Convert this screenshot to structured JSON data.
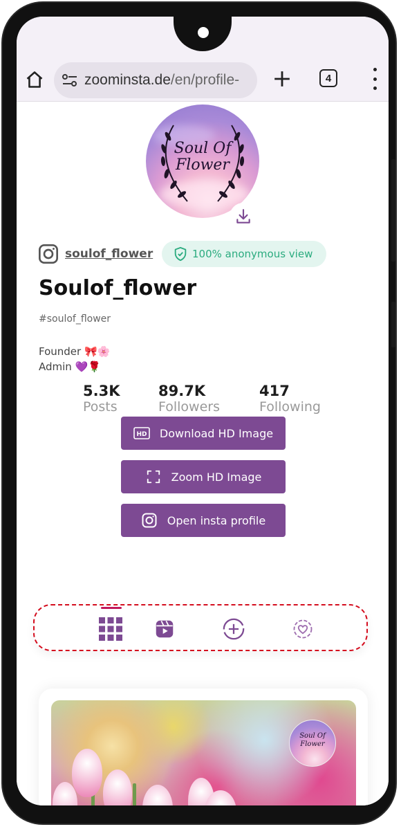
{
  "browser": {
    "url_main": "zoominsta.de",
    "url_path": "/en/profile-",
    "tab_count": "4"
  },
  "profile": {
    "avatar_text_line1": "Soul Of",
    "avatar_text_line2": "Flower",
    "username": "soulof_flower",
    "anonymous_label": "100% anonymous view",
    "display_name": "Soulof_flower",
    "hashtag": "#soulof_flower",
    "bio_line1": "Founder 🎀🌸",
    "bio_line2": "Admin 💜🌹"
  },
  "stats": [
    {
      "value": "5.3K",
      "label": "Posts"
    },
    {
      "value": "89.7K",
      "label": "Followers"
    },
    {
      "value": "417",
      "label": "Following"
    }
  ],
  "actions": {
    "download": "Download HD Image",
    "zoom": "Zoom HD Image",
    "open": "Open insta profile"
  },
  "tabs": {
    "active": "posts-grid",
    "items": [
      "posts-grid",
      "reels",
      "add",
      "tagged"
    ]
  },
  "colors": {
    "accent_purple": "#7d4a93",
    "active_tab_underline": "#c2185b",
    "anon_text": "#2bab7f",
    "highlight_dashed": "#d40d1e"
  }
}
